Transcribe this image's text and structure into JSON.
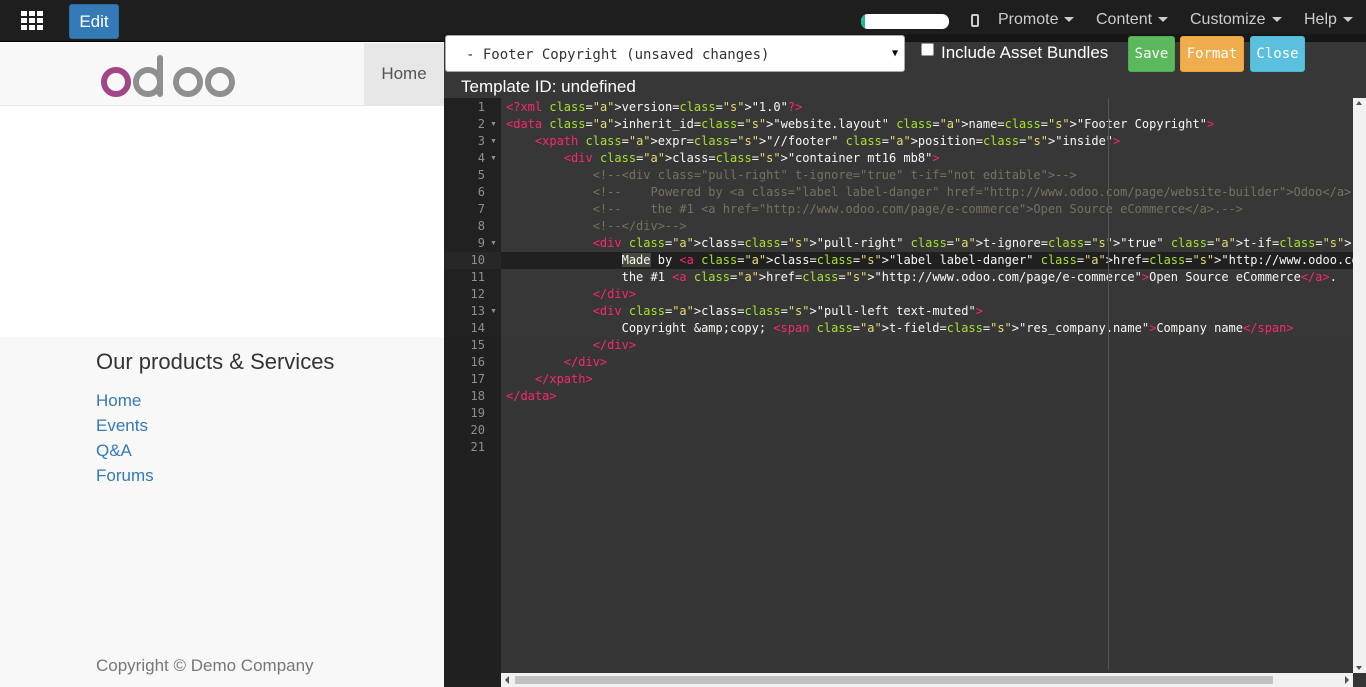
{
  "topbar": {
    "edit_label": "Edit",
    "progress": 0.05,
    "menus": [
      {
        "label": "Promote"
      },
      {
        "label": "Content"
      },
      {
        "label": "Customize"
      },
      {
        "label": "Help"
      }
    ]
  },
  "site": {
    "logo_text": "odoo",
    "nav_home": "Home"
  },
  "footer": {
    "heading": "Our products & Services",
    "links": [
      "Home",
      "Events",
      "Q&A",
      "Forums"
    ],
    "copyright": "Copyright © Demo Company"
  },
  "editor": {
    "template_select": "- Footer Copyright (unsaved changes)",
    "include_asset_bundles_label": "Include Asset Bundles",
    "include_asset_bundles_checked": false,
    "save_label": "Save",
    "format_label": "Format",
    "close_label": "Close",
    "template_id_text": "Template ID: undefined",
    "active_line": 10,
    "line_numbers": [
      "1",
      "2",
      "3",
      "4",
      "5",
      "6",
      "7",
      "8",
      "9",
      "10",
      "11",
      "12",
      "13",
      "14",
      "15",
      "16",
      "17",
      "18",
      "19",
      "20",
      "21"
    ],
    "code_lines": [
      "<?xml version=\"1.0\"?>",
      "<data inherit_id=\"website.layout\" name=\"Footer Copyright\">",
      "    <xpath expr=\"//footer\" position=\"inside\">",
      "        <div class=\"container mt16 mb8\">",
      "            <!--<div class=\"pull-right\" t-ignore=\"true\" t-if=\"not editable\">-->",
      "            <!--    Powered by <a class=\"label label-danger\" href=\"http://www.odoo.com/page/website-builder\">Odoo</a>,-->",
      "            <!--    the #1 <a href=\"http://www.odoo.com/page/e-commerce\">Open Source eCommerce</a>.-->",
      "            <!--</div>-->",
      "            <div class=\"pull-right\" t-ignore=\"true\" t-if=\"not editable\">",
      "                Made by <a class=\"label label-danger\" href=\"http://www.odoo.com/page/website-builder\">Odoo</a>,",
      "                the #1 <a href=\"http://www.odoo.com/page/e-commerce\">Open Source eCommerce</a>.",
      "            </div>",
      "            <div class=\"pull-left text-muted\">",
      "                Copyright &amp;copy; <span t-field=\"res_company.name\">Company name</span>",
      "            </div>",
      "        </div>",
      "    </xpath>",
      "</data>",
      "",
      "",
      ""
    ]
  },
  "colors": {
    "edit_button": "#337ab7",
    "save_button": "#5cb85c",
    "format_button": "#f0ad4e",
    "close_button": "#5bc0de",
    "link": "#337ab7"
  }
}
